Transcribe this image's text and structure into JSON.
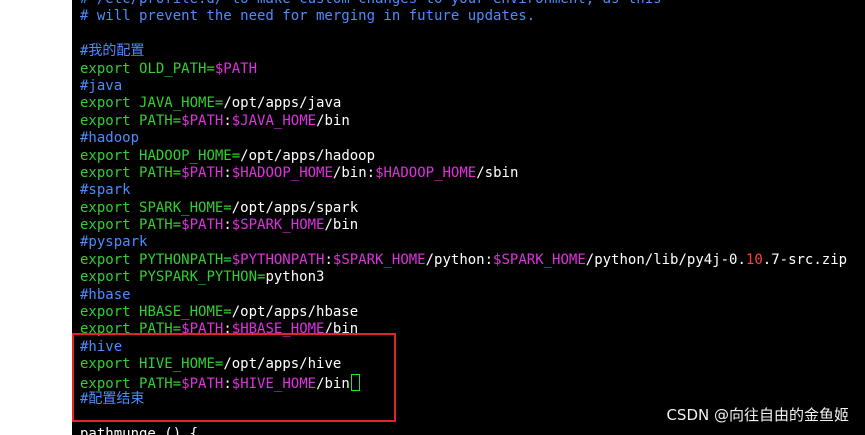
{
  "colors": {
    "comment": "#4d8cff",
    "keyword": "#30d030",
    "variable": "#e030e0",
    "number": "#ff4040",
    "text": "#ffffff",
    "background": "#000000",
    "highlight_border": "#e0242a",
    "cursor": "#30e030"
  },
  "lines": [
    [
      {
        "t": "# /etc/profile.d/ to make custom changes to your environment, as this",
        "c": "comment"
      }
    ],
    [
      {
        "t": "# will prevent the need for merging in future updates.",
        "c": "comment"
      }
    ],
    [
      {
        "t": "",
        "c": "plain"
      }
    ],
    [
      {
        "t": "#我的配置",
        "c": "comment"
      }
    ],
    [
      {
        "t": "export ",
        "c": "keyword"
      },
      {
        "t": "OLD_PATH=",
        "c": "keyword"
      },
      {
        "t": "$PATH",
        "c": "var"
      }
    ],
    [
      {
        "t": "#java",
        "c": "comment"
      }
    ],
    [
      {
        "t": "export ",
        "c": "keyword"
      },
      {
        "t": "JAVA_HOME=",
        "c": "keyword"
      },
      {
        "t": "/opt/apps/java",
        "c": "plain"
      }
    ],
    [
      {
        "t": "export ",
        "c": "keyword"
      },
      {
        "t": "PATH=",
        "c": "keyword"
      },
      {
        "t": "$PATH",
        "c": "var"
      },
      {
        "t": ":",
        "c": "plain"
      },
      {
        "t": "$JAVA_HOME",
        "c": "var"
      },
      {
        "t": "/bin",
        "c": "plain"
      }
    ],
    [
      {
        "t": "#hadoop",
        "c": "comment"
      }
    ],
    [
      {
        "t": "export ",
        "c": "keyword"
      },
      {
        "t": "HADOOP_HOME=",
        "c": "keyword"
      },
      {
        "t": "/opt/apps/hadoop",
        "c": "plain"
      }
    ],
    [
      {
        "t": "export ",
        "c": "keyword"
      },
      {
        "t": "PATH=",
        "c": "keyword"
      },
      {
        "t": "$PATH",
        "c": "var"
      },
      {
        "t": ":",
        "c": "plain"
      },
      {
        "t": "$HADOOP_HOME",
        "c": "var"
      },
      {
        "t": "/bin:",
        "c": "plain"
      },
      {
        "t": "$HADOOP_HOME",
        "c": "var"
      },
      {
        "t": "/sbin",
        "c": "plain"
      }
    ],
    [
      {
        "t": "#spark",
        "c": "comment"
      }
    ],
    [
      {
        "t": "export ",
        "c": "keyword"
      },
      {
        "t": "SPARK_HOME=",
        "c": "keyword"
      },
      {
        "t": "/opt/apps/spark",
        "c": "plain"
      }
    ],
    [
      {
        "t": "export ",
        "c": "keyword"
      },
      {
        "t": "PATH=",
        "c": "keyword"
      },
      {
        "t": "$PATH",
        "c": "var"
      },
      {
        "t": ":",
        "c": "plain"
      },
      {
        "t": "$SPARK_HOME",
        "c": "var"
      },
      {
        "t": "/bin",
        "c": "plain"
      }
    ],
    [
      {
        "t": "#pyspark",
        "c": "comment"
      }
    ],
    [
      {
        "t": "export ",
        "c": "keyword"
      },
      {
        "t": "PYTHONPATH=",
        "c": "keyword"
      },
      {
        "t": "$PYTHONPATH",
        "c": "var"
      },
      {
        "t": ":",
        "c": "plain"
      },
      {
        "t": "$SPARK_HOME",
        "c": "var"
      },
      {
        "t": "/python:",
        "c": "plain"
      },
      {
        "t": "$SPARK_HOME",
        "c": "var"
      },
      {
        "t": "/python/lib/py4j-0.",
        "c": "plain"
      },
      {
        "t": "10",
        "c": "num"
      },
      {
        "t": ".7-src.zip",
        "c": "plain"
      }
    ],
    [
      {
        "t": "export ",
        "c": "keyword"
      },
      {
        "t": "PYSPARK_PYTHON=",
        "c": "keyword"
      },
      {
        "t": "python3",
        "c": "plain"
      }
    ],
    [
      {
        "t": "#hbase",
        "c": "comment"
      }
    ],
    [
      {
        "t": "export ",
        "c": "keyword"
      },
      {
        "t": "HBASE_HOME=",
        "c": "keyword"
      },
      {
        "t": "/opt/apps/hbase",
        "c": "plain"
      }
    ],
    [
      {
        "t": "export ",
        "c": "keyword"
      },
      {
        "t": "PATH=",
        "c": "keyword"
      },
      {
        "t": "$PATH",
        "c": "var"
      },
      {
        "t": ":",
        "c": "plain"
      },
      {
        "t": "$HBASE_HOME",
        "c": "var"
      },
      {
        "t": "/bin",
        "c": "plain"
      }
    ],
    [
      {
        "t": "#hive",
        "c": "comment"
      }
    ],
    [
      {
        "t": "export ",
        "c": "keyword"
      },
      {
        "t": "HIVE_HOME=",
        "c": "keyword"
      },
      {
        "t": "/opt/apps/hive",
        "c": "plain"
      }
    ],
    [
      {
        "t": "export ",
        "c": "keyword"
      },
      {
        "t": "PATH=",
        "c": "keyword"
      },
      {
        "t": "$PATH",
        "c": "var"
      },
      {
        "t": ":",
        "c": "plain"
      },
      {
        "t": "$HIVE_HOME",
        "c": "var"
      },
      {
        "t": "/bin",
        "c": "plain"
      },
      {
        "t": "",
        "c": "cursor"
      }
    ],
    [
      {
        "t": "#配置结束",
        "c": "comment"
      }
    ],
    [
      {
        "t": "",
        "c": "plain"
      }
    ],
    [
      {
        "t": "pathmunge () {",
        "c": "plain"
      }
    ]
  ],
  "watermark": "CSDN @向往自由的金鱼姬"
}
